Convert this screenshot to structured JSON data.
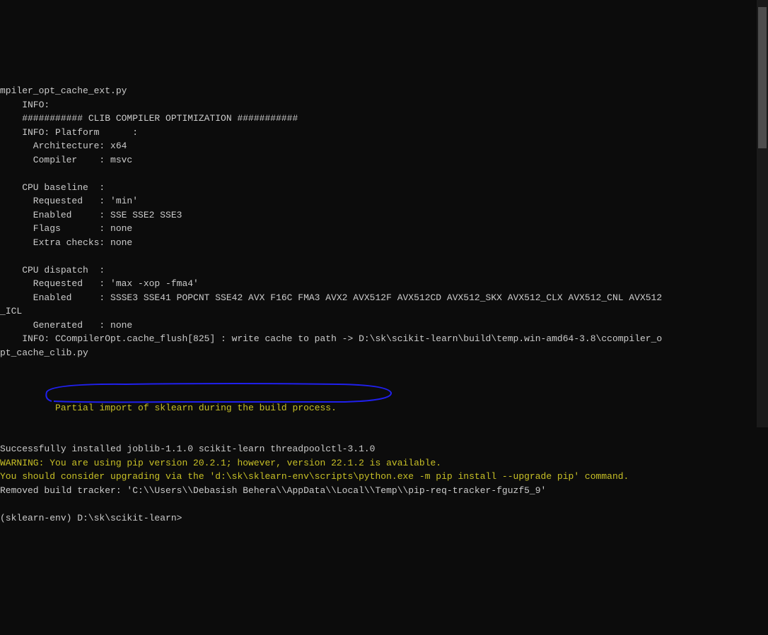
{
  "terminal": {
    "lines": [
      {
        "text": "mpiler_opt_cache_ext.py",
        "class": "white"
      },
      {
        "text": "    INFO:",
        "class": "white"
      },
      {
        "text": "    ########### CLIB COMPILER OPTIMIZATION ###########",
        "class": "white"
      },
      {
        "text": "    INFO: Platform      :",
        "class": "white"
      },
      {
        "text": "      Architecture: x64",
        "class": "white"
      },
      {
        "text": "      Compiler    : msvc",
        "class": "white"
      },
      {
        "text": "",
        "class": "white"
      },
      {
        "text": "    CPU baseline  :",
        "class": "white"
      },
      {
        "text": "      Requested   : 'min'",
        "class": "white"
      },
      {
        "text": "      Enabled     : SSE SSE2 SSE3",
        "class": "white"
      },
      {
        "text": "      Flags       : none",
        "class": "white"
      },
      {
        "text": "      Extra checks: none",
        "class": "white"
      },
      {
        "text": "",
        "class": "white"
      },
      {
        "text": "    CPU dispatch  :",
        "class": "white"
      },
      {
        "text": "      Requested   : 'max -xop -fma4'",
        "class": "white"
      },
      {
        "text": "      Enabled     : SSSE3 SSE41 POPCNT SSE42 AVX F16C FMA3 AVX2 AVX512F AVX512CD AVX512_SKX AVX512_CLX AVX512_CNL AVX512",
        "class": "white"
      },
      {
        "text": "_ICL",
        "class": "white"
      },
      {
        "text": "      Generated   : none",
        "class": "white"
      },
      {
        "text": "    INFO: CCompilerOpt.cache_flush[825] : write cache to path -> D:\\sk\\scikit-learn\\build\\temp.win-amd64-3.8\\ccompiler_o",
        "class": "white"
      },
      {
        "text": "pt_cache_clib.py",
        "class": "white"
      }
    ],
    "highlighted": "    Partial import of sklearn during the build process.",
    "after": [
      {
        "text": "Successfully installed joblib-1.1.0 scikit-learn threadpoolctl-3.1.0",
        "class": "white"
      },
      {
        "text": "WARNING: You are using pip version 20.2.1; however, version 22.1.2 is available.",
        "class": "yellow"
      },
      {
        "text": "You should consider upgrading via the 'd:\\sk\\sklearn-env\\scripts\\python.exe -m pip install --upgrade pip' command.",
        "class": "yellow"
      },
      {
        "text": "Removed build tracker: 'C:\\\\Users\\\\Debasish Behera\\\\AppData\\\\Local\\\\Temp\\\\pip-req-tracker-fguzf5_9'",
        "class": "white"
      },
      {
        "text": "",
        "class": "white"
      },
      {
        "text": "(sklearn-env) D:\\sk\\scikit-learn>",
        "class": "white"
      }
    ]
  }
}
